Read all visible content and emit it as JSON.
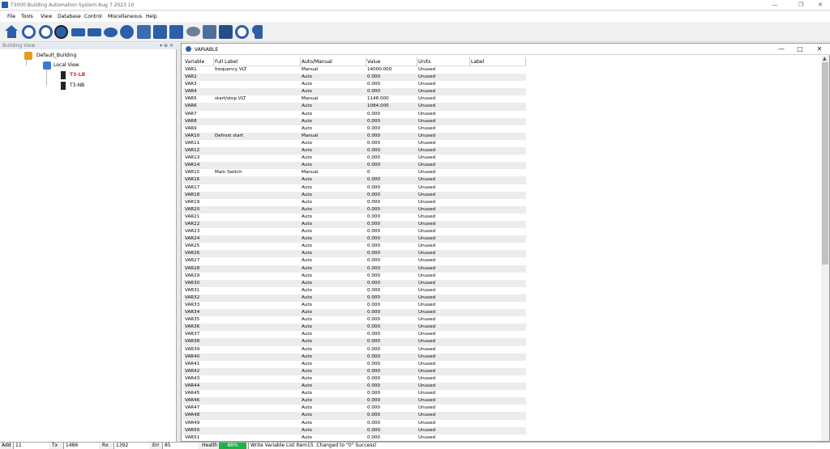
{
  "window": {
    "title": "T3000 Building Automation System   Aug  7 2023 10",
    "controls": {
      "minimize": "—",
      "restore": "❐",
      "close": "✕"
    }
  },
  "menu": [
    "File",
    "Tools",
    "View",
    "Database",
    "Control",
    "Miscellaneous",
    "Help"
  ],
  "toolbar": {
    "icons": [
      "home-icon",
      "gear-cycle-icon",
      "settings-gear-icon",
      "globe-icon",
      "pump-icon",
      "fan-icon",
      "valve-icon",
      "grid-icon",
      "chart-icon",
      "graph-icon",
      "camera-icon",
      "network-icon",
      "monitor-icon",
      "gear-icon",
      "search-icon",
      "device-icon"
    ]
  },
  "building_view": {
    "title": "Building View",
    "controls": "▾ ⊕ ✕",
    "tree": {
      "root": "Default_Building",
      "child": "Local View",
      "devices": [
        {
          "name": "T3-LB",
          "color": "#c0392b"
        },
        {
          "name": "T3-NB",
          "color": "#000000"
        }
      ]
    }
  },
  "variable_window": {
    "title": "VARIABLE",
    "controls": {
      "minimize": "—",
      "maximize": "□",
      "close": "✕"
    },
    "columns": [
      "Variable",
      "Full Label",
      "Auto/Manual",
      "Value",
      "Units",
      "Label"
    ],
    "rows": [
      [
        "VAR1",
        "frequency VLT",
        "Manual",
        "14000.000",
        "Unused"
      ],
      [
        "VAR2",
        "",
        "Auto",
        "0.000",
        "Unused"
      ],
      [
        "VAR3",
        "",
        "Auto",
        "0.000",
        "Unused"
      ],
      [
        "VAR4",
        "",
        "Auto",
        "0.000",
        "Unused"
      ],
      [
        "VAR5",
        "start/stop VLT",
        "Manual",
        "1148.000",
        "Unused"
      ],
      [
        "VAR6",
        "",
        "Auto",
        "1084.000",
        "Unused"
      ],
      [
        "VAR7",
        "",
        "Auto",
        "0.000",
        "Unused"
      ],
      [
        "VAR8",
        "",
        "Auto",
        "0.000",
        "Unused"
      ],
      [
        "VAR9",
        "",
        "Auto",
        "0.000",
        "Unused"
      ],
      [
        "VAR10",
        "Defrost start",
        "Manual",
        "0.000",
        "Unused"
      ],
      [
        "VAR11",
        "",
        "Auto",
        "0.000",
        "Unused"
      ],
      [
        "VAR12",
        "",
        "Auto",
        "0.000",
        "Unused"
      ],
      [
        "VAR13",
        "",
        "Auto",
        "0.000",
        "Unused"
      ],
      [
        "VAR14",
        "",
        "Auto",
        "0.000",
        "Unused"
      ],
      [
        "VAR15",
        "Main Switch",
        "Manual",
        "0",
        "Unused"
      ],
      [
        "VAR16",
        "",
        "Auto",
        "0.000",
        "Unused"
      ],
      [
        "VAR17",
        "",
        "Auto",
        "0.000",
        "Unused"
      ],
      [
        "VAR18",
        "",
        "Auto",
        "0.000",
        "Unused"
      ],
      [
        "VAR19",
        "",
        "Auto",
        "0.000",
        "Unused"
      ],
      [
        "VAR20",
        "",
        "Auto",
        "0.000",
        "Unused"
      ],
      [
        "VAR21",
        "",
        "Auto",
        "0.000",
        "Unused"
      ],
      [
        "VAR22",
        "",
        "Auto",
        "0.000",
        "Unused"
      ],
      [
        "VAR23",
        "",
        "Auto",
        "0.000",
        "Unused"
      ],
      [
        "VAR24",
        "",
        "Auto",
        "0.000",
        "Unused"
      ],
      [
        "VAR25",
        "",
        "Auto",
        "0.000",
        "Unused"
      ],
      [
        "VAR26",
        "",
        "Auto",
        "0.000",
        "Unused"
      ],
      [
        "VAR27",
        "",
        "Auto",
        "0.000",
        "Unused"
      ],
      [
        "VAR28",
        "",
        "Auto",
        "0.000",
        "Unused"
      ],
      [
        "VAR29",
        "",
        "Auto",
        "0.000",
        "Unused"
      ],
      [
        "VAR30",
        "",
        "Auto",
        "0.000",
        "Unused"
      ],
      [
        "VAR31",
        "",
        "Auto",
        "0.000",
        "Unused"
      ],
      [
        "VAR32",
        "",
        "Auto",
        "0.000",
        "Unused"
      ],
      [
        "VAR33",
        "",
        "Auto",
        "0.000",
        "Unused"
      ],
      [
        "VAR34",
        "",
        "Auto",
        "0.000",
        "Unused"
      ],
      [
        "VAR35",
        "",
        "Auto",
        "0.000",
        "Unused"
      ],
      [
        "VAR36",
        "",
        "Auto",
        "0.000",
        "Unused"
      ],
      [
        "VAR37",
        "",
        "Auto",
        "0.000",
        "Unused"
      ],
      [
        "VAR38",
        "",
        "Auto",
        "0.000",
        "Unused"
      ],
      [
        "VAR39",
        "",
        "Auto",
        "0.000",
        "Unused"
      ],
      [
        "VAR40",
        "",
        "Auto",
        "0.000",
        "Unused"
      ],
      [
        "VAR41",
        "",
        "Auto",
        "0.000",
        "Unused"
      ],
      [
        "VAR42",
        "",
        "Auto",
        "0.000",
        "Unused"
      ],
      [
        "VAR43",
        "",
        "Auto",
        "0.000",
        "Unused"
      ],
      [
        "VAR44",
        "",
        "Auto",
        "0.000",
        "Unused"
      ],
      [
        "VAR45",
        "",
        "Auto",
        "0.000",
        "Unused"
      ],
      [
        "VAR46",
        "",
        "Auto",
        "0.000",
        "Unused"
      ],
      [
        "VAR47",
        "",
        "Auto",
        "0.000",
        "Unused"
      ],
      [
        "VAR48",
        "",
        "Auto",
        "0.000",
        "Unused"
      ],
      [
        "VAR49",
        "",
        "Auto",
        "0.000",
        "Unused"
      ],
      [
        "VAR50",
        "",
        "Auto",
        "0.000",
        "Unused"
      ],
      [
        "VAR51",
        "",
        "Auto",
        "0.000",
        "Unused"
      ]
    ]
  },
  "status_bar": {
    "add_label": "Add",
    "add_value": "11",
    "tx_label": "Tx",
    "tx_value": "1486",
    "rx_label": "Rx",
    "rx_value": "1392",
    "err_label": "Err",
    "err_value": "85",
    "health_label": "Health",
    "health_value": "88%",
    "message": "Write Variable List Item15 .Changed to \"0\" Success!"
  },
  "colors": {
    "accent": "#2d5fa8",
    "health": "#1fb24a"
  }
}
